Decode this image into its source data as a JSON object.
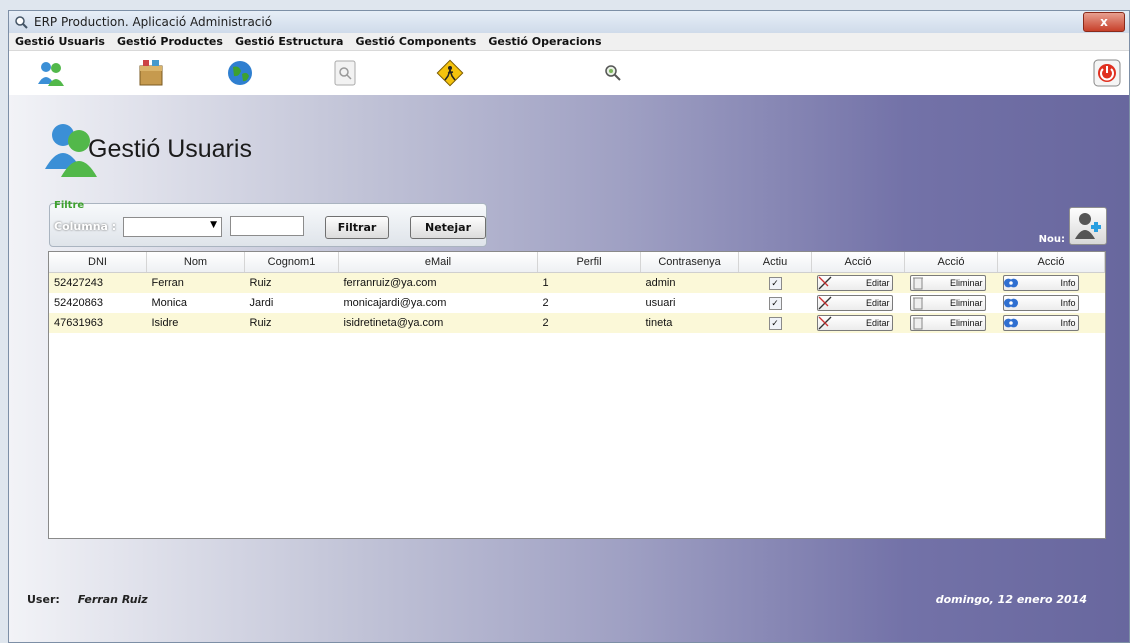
{
  "window": {
    "title": "ERP Production. Aplicació Administració",
    "close_label": "x"
  },
  "menu": [
    "Gestió Usuaris",
    "Gestió Productes",
    "Gestió Estructura",
    "Gestió Components",
    "Gestió Operacions"
  ],
  "toolbar": {
    "icons": [
      "users-icon",
      "products-box-icon",
      "globe-icon",
      "components-icon",
      "operations-sign-icon",
      "search-icon",
      "power-icon"
    ]
  },
  "page": {
    "title": "Gestió Usuaris"
  },
  "filter": {
    "legend": "Filtre",
    "column_label": "Columna :",
    "column_value": "",
    "text_value": "",
    "filter_button": "Filtrar",
    "clear_button": "Netejar"
  },
  "new": {
    "label": "Nou:"
  },
  "table": {
    "columns": [
      "DNI",
      "Nom",
      "Cognom1",
      "eMail",
      "Perfil",
      "Contrasenya",
      "Actiu",
      "Acció",
      "Acció",
      "Acció"
    ],
    "rows": [
      {
        "dni": "52427243",
        "nom": "Ferran",
        "cognom": "Ruiz",
        "email": "ferranruiz@ya.com",
        "perfil": "1",
        "contrasenya": "admin",
        "actiu": true
      },
      {
        "dni": "52420863",
        "nom": "Monica",
        "cognom": "Jardi",
        "email": "monicajardi@ya.com",
        "perfil": "2",
        "contrasenya": "usuari",
        "actiu": true
      },
      {
        "dni": "47631963",
        "nom": "Isidre",
        "cognom": "Ruiz",
        "email": "isidretineta@ya.com",
        "perfil": "2",
        "contrasenya": "tineta",
        "actiu": true
      }
    ],
    "edit_label": "Editar",
    "delete_label": "Eliminar",
    "info_label": "Info",
    "check_mark": "✓"
  },
  "footer": {
    "user_label": "User:",
    "user_name": "Ferran Ruiz",
    "date": "domingo, 12 enero 2014"
  },
  "colors": {
    "row_highlight": "#fbf8d8",
    "filter_legend": "#3ea12e",
    "close_button": "#c7402a"
  }
}
